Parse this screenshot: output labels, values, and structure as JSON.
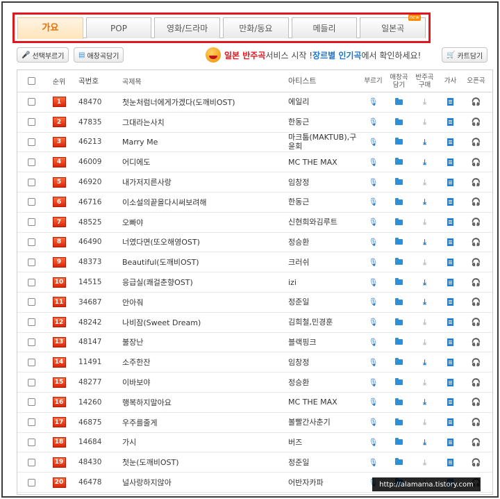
{
  "tabs": [
    {
      "label": "가요",
      "active": true
    },
    {
      "label": "POP",
      "active": false
    },
    {
      "label": "영화/드라마",
      "active": false
    },
    {
      "label": "만화/동요",
      "active": false
    },
    {
      "label": "메들리",
      "active": false
    },
    {
      "label": "일본곡",
      "active": false,
      "badge": "new"
    }
  ],
  "toolbar": {
    "select_sing_label": "선택부르기",
    "favorite_label": "애창곡담기",
    "cart_label": "카트담기"
  },
  "promo": {
    "highlight1": "일본 반주곡",
    "text1": " 서비스 시작 ! ",
    "highlight2": "장르별 인기곡",
    "text2": "에서 확인하세요!"
  },
  "table": {
    "headers": {
      "rank": "순위",
      "number": "곡번호",
      "title": "곡제목",
      "artist": "아티스트",
      "sing": "부르기",
      "favorite": "애창곡\n담기",
      "buy": "반주곡\n구매",
      "lyrics": "가사",
      "open": "오픈곡"
    },
    "rows": [
      {
        "rank": "1",
        "number": "48470",
        "title": "첫눈처럼너에게가겠다(도깨비OST)",
        "artist": "에일리",
        "buy": false,
        "open": false
      },
      {
        "rank": "2",
        "number": "47835",
        "title": "그대라는사치",
        "artist": "한동근",
        "buy": false,
        "open": false
      },
      {
        "rank": "3",
        "number": "46213",
        "title": "Marry Me",
        "artist": "마크툽(MAKTUB),구윤회",
        "buy": true,
        "open": false
      },
      {
        "rank": "4",
        "number": "46009",
        "title": "어디에도",
        "artist": "MC THE MAX",
        "buy": true,
        "open": true
      },
      {
        "rank": "5",
        "number": "46920",
        "title": "내가저지른사랑",
        "artist": "임창정",
        "buy": false,
        "open": true
      },
      {
        "rank": "6",
        "number": "46716",
        "title": "이소설의끝을다시써보려해",
        "artist": "한동근",
        "buy": true,
        "open": true
      },
      {
        "rank": "7",
        "number": "48525",
        "title": "오빠야",
        "artist": "신현희와김루트",
        "buy": false,
        "open": false
      },
      {
        "rank": "8",
        "number": "46490",
        "title": "너였다면(또오해영OST)",
        "artist": "정승환",
        "buy": true,
        "open": true
      },
      {
        "rank": "9",
        "number": "48373",
        "title": "Beautiful(도깨비OST)",
        "artist": "크러쉬",
        "buy": false,
        "open": false
      },
      {
        "rank": "10",
        "number": "14515",
        "title": "응급실(쾌걸춘향OST)",
        "artist": "izi",
        "buy": true,
        "open": true
      },
      {
        "rank": "11",
        "number": "34687",
        "title": "안아줘",
        "artist": "정준일",
        "buy": true,
        "open": true
      },
      {
        "rank": "12",
        "number": "48242",
        "title": "나비잠(Sweet Dream)",
        "artist": "김희철,민경훈",
        "buy": false,
        "open": false
      },
      {
        "rank": "13",
        "number": "48147",
        "title": "불장난",
        "artist": "블랙핑크",
        "buy": false,
        "open": false
      },
      {
        "rank": "14",
        "number": "11491",
        "title": "소주한잔",
        "artist": "임창정",
        "buy": true,
        "open": true
      },
      {
        "rank": "15",
        "number": "48277",
        "title": "이바보야",
        "artist": "정승환",
        "buy": false,
        "open": false
      },
      {
        "rank": "16",
        "number": "14260",
        "title": "행복하지말아요",
        "artist": "MC THE MAX",
        "buy": true,
        "open": true
      },
      {
        "rank": "17",
        "number": "46875",
        "title": "우주를줄게",
        "artist": "볼빨간사춘기",
        "buy": false,
        "open": false
      },
      {
        "rank": "18",
        "number": "14684",
        "title": "가시",
        "artist": "버즈",
        "buy": true,
        "open": true
      },
      {
        "rank": "19",
        "number": "48430",
        "title": "첫눈(도깨비OST)",
        "artist": "정준일",
        "buy": false,
        "open": false
      },
      {
        "rank": "20",
        "number": "46478",
        "title": "널사랑하지않아",
        "artist": "어반자카파",
        "buy": true,
        "open": true
      }
    ]
  },
  "watermark": "http://alamama.tistory.com",
  "colors": {
    "accent": "#e0161e",
    "tab_active_text": "#e96d00",
    "link_blue": "#1b73c9",
    "rank_bg": "#e0400f"
  }
}
